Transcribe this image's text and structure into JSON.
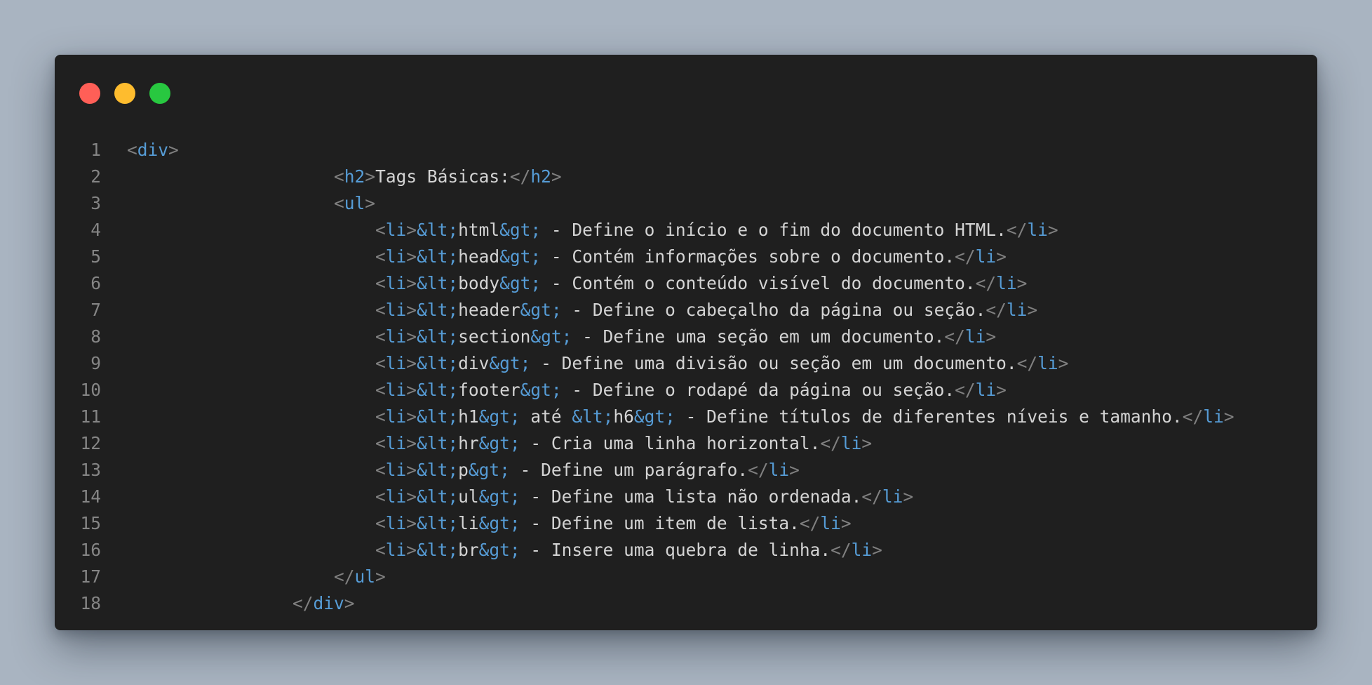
{
  "colors": {
    "background": "#a9b4c1",
    "window": "#1f1f1f",
    "dot_close": "#ff5f57",
    "dot_minimize": "#febc2e",
    "dot_maximize": "#28c840",
    "line_number": "#858585",
    "bracket": "#808080",
    "tag": "#569cd6",
    "entity": "#569cd6",
    "text": "#d4d4d4"
  },
  "window_controls": {
    "close_icon": "close-dot-icon",
    "minimize_icon": "minimize-dot-icon",
    "maximize_icon": "maximize-dot-icon"
  },
  "code": {
    "lines": [
      {
        "number": "1",
        "indent": "",
        "tokens": [
          {
            "t": "brk",
            "v": "<"
          },
          {
            "t": "tag",
            "v": "div"
          },
          {
            "t": "brk",
            "v": ">"
          }
        ]
      },
      {
        "number": "2",
        "indent": "                    ",
        "tokens": [
          {
            "t": "brk",
            "v": "<"
          },
          {
            "t": "tag",
            "v": "h2"
          },
          {
            "t": "brk",
            "v": ">"
          },
          {
            "t": "txt",
            "v": "Tags Básicas:"
          },
          {
            "t": "brk",
            "v": "</"
          },
          {
            "t": "tag",
            "v": "h2"
          },
          {
            "t": "brk",
            "v": ">"
          }
        ]
      },
      {
        "number": "3",
        "indent": "                    ",
        "tokens": [
          {
            "t": "brk",
            "v": "<"
          },
          {
            "t": "tag",
            "v": "ul"
          },
          {
            "t": "brk",
            "v": ">"
          }
        ]
      },
      {
        "number": "4",
        "indent": "                        ",
        "tokens": [
          {
            "t": "brk",
            "v": "<"
          },
          {
            "t": "tag",
            "v": "li"
          },
          {
            "t": "brk",
            "v": ">"
          },
          {
            "t": "ent",
            "v": "&lt;"
          },
          {
            "t": "txt",
            "v": "html"
          },
          {
            "t": "ent",
            "v": "&gt;"
          },
          {
            "t": "txt",
            "v": " - Define o início e o fim do documento HTML."
          },
          {
            "t": "brk",
            "v": "</"
          },
          {
            "t": "tag",
            "v": "li"
          },
          {
            "t": "brk",
            "v": ">"
          }
        ]
      },
      {
        "number": "5",
        "indent": "                        ",
        "tokens": [
          {
            "t": "brk",
            "v": "<"
          },
          {
            "t": "tag",
            "v": "li"
          },
          {
            "t": "brk",
            "v": ">"
          },
          {
            "t": "ent",
            "v": "&lt;"
          },
          {
            "t": "txt",
            "v": "head"
          },
          {
            "t": "ent",
            "v": "&gt;"
          },
          {
            "t": "txt",
            "v": " - Contém informações sobre o documento."
          },
          {
            "t": "brk",
            "v": "</"
          },
          {
            "t": "tag",
            "v": "li"
          },
          {
            "t": "brk",
            "v": ">"
          }
        ]
      },
      {
        "number": "6",
        "indent": "                        ",
        "tokens": [
          {
            "t": "brk",
            "v": "<"
          },
          {
            "t": "tag",
            "v": "li"
          },
          {
            "t": "brk",
            "v": ">"
          },
          {
            "t": "ent",
            "v": "&lt;"
          },
          {
            "t": "txt",
            "v": "body"
          },
          {
            "t": "ent",
            "v": "&gt;"
          },
          {
            "t": "txt",
            "v": " - Contém o conteúdo visível do documento."
          },
          {
            "t": "brk",
            "v": "</"
          },
          {
            "t": "tag",
            "v": "li"
          },
          {
            "t": "brk",
            "v": ">"
          }
        ]
      },
      {
        "number": "7",
        "indent": "                        ",
        "tokens": [
          {
            "t": "brk",
            "v": "<"
          },
          {
            "t": "tag",
            "v": "li"
          },
          {
            "t": "brk",
            "v": ">"
          },
          {
            "t": "ent",
            "v": "&lt;"
          },
          {
            "t": "txt",
            "v": "header"
          },
          {
            "t": "ent",
            "v": "&gt;"
          },
          {
            "t": "txt",
            "v": " - Define o cabeçalho da página ou seção."
          },
          {
            "t": "brk",
            "v": "</"
          },
          {
            "t": "tag",
            "v": "li"
          },
          {
            "t": "brk",
            "v": ">"
          }
        ]
      },
      {
        "number": "8",
        "indent": "                        ",
        "tokens": [
          {
            "t": "brk",
            "v": "<"
          },
          {
            "t": "tag",
            "v": "li"
          },
          {
            "t": "brk",
            "v": ">"
          },
          {
            "t": "ent",
            "v": "&lt;"
          },
          {
            "t": "txt",
            "v": "section"
          },
          {
            "t": "ent",
            "v": "&gt;"
          },
          {
            "t": "txt",
            "v": " - Define uma seção em um documento."
          },
          {
            "t": "brk",
            "v": "</"
          },
          {
            "t": "tag",
            "v": "li"
          },
          {
            "t": "brk",
            "v": ">"
          }
        ]
      },
      {
        "number": "9",
        "indent": "                        ",
        "tokens": [
          {
            "t": "brk",
            "v": "<"
          },
          {
            "t": "tag",
            "v": "li"
          },
          {
            "t": "brk",
            "v": ">"
          },
          {
            "t": "ent",
            "v": "&lt;"
          },
          {
            "t": "txt",
            "v": "div"
          },
          {
            "t": "ent",
            "v": "&gt;"
          },
          {
            "t": "txt",
            "v": " - Define uma divisão ou seção em um documento."
          },
          {
            "t": "brk",
            "v": "</"
          },
          {
            "t": "tag",
            "v": "li"
          },
          {
            "t": "brk",
            "v": ">"
          }
        ]
      },
      {
        "number": "10",
        "indent": "                        ",
        "tokens": [
          {
            "t": "brk",
            "v": "<"
          },
          {
            "t": "tag",
            "v": "li"
          },
          {
            "t": "brk",
            "v": ">"
          },
          {
            "t": "ent",
            "v": "&lt;"
          },
          {
            "t": "txt",
            "v": "footer"
          },
          {
            "t": "ent",
            "v": "&gt;"
          },
          {
            "t": "txt",
            "v": " - Define o rodapé da página ou seção."
          },
          {
            "t": "brk",
            "v": "</"
          },
          {
            "t": "tag",
            "v": "li"
          },
          {
            "t": "brk",
            "v": ">"
          }
        ]
      },
      {
        "number": "11",
        "indent": "                        ",
        "tokens": [
          {
            "t": "brk",
            "v": "<"
          },
          {
            "t": "tag",
            "v": "li"
          },
          {
            "t": "brk",
            "v": ">"
          },
          {
            "t": "ent",
            "v": "&lt;"
          },
          {
            "t": "txt",
            "v": "h1"
          },
          {
            "t": "ent",
            "v": "&gt;"
          },
          {
            "t": "txt",
            "v": " até "
          },
          {
            "t": "ent",
            "v": "&lt;"
          },
          {
            "t": "txt",
            "v": "h6"
          },
          {
            "t": "ent",
            "v": "&gt;"
          },
          {
            "t": "txt",
            "v": " - Define títulos de diferentes níveis e tamanho."
          },
          {
            "t": "brk",
            "v": "</"
          },
          {
            "t": "tag",
            "v": "li"
          },
          {
            "t": "brk",
            "v": ">"
          }
        ]
      },
      {
        "number": "12",
        "indent": "                        ",
        "tokens": [
          {
            "t": "brk",
            "v": "<"
          },
          {
            "t": "tag",
            "v": "li"
          },
          {
            "t": "brk",
            "v": ">"
          },
          {
            "t": "ent",
            "v": "&lt;"
          },
          {
            "t": "txt",
            "v": "hr"
          },
          {
            "t": "ent",
            "v": "&gt;"
          },
          {
            "t": "txt",
            "v": " - Cria uma linha horizontal."
          },
          {
            "t": "brk",
            "v": "</"
          },
          {
            "t": "tag",
            "v": "li"
          },
          {
            "t": "brk",
            "v": ">"
          }
        ]
      },
      {
        "number": "13",
        "indent": "                        ",
        "tokens": [
          {
            "t": "brk",
            "v": "<"
          },
          {
            "t": "tag",
            "v": "li"
          },
          {
            "t": "brk",
            "v": ">"
          },
          {
            "t": "ent",
            "v": "&lt;"
          },
          {
            "t": "txt",
            "v": "p"
          },
          {
            "t": "ent",
            "v": "&gt;"
          },
          {
            "t": "txt",
            "v": " - Define um parágrafo."
          },
          {
            "t": "brk",
            "v": "</"
          },
          {
            "t": "tag",
            "v": "li"
          },
          {
            "t": "brk",
            "v": ">"
          }
        ]
      },
      {
        "number": "14",
        "indent": "                        ",
        "tokens": [
          {
            "t": "brk",
            "v": "<"
          },
          {
            "t": "tag",
            "v": "li"
          },
          {
            "t": "brk",
            "v": ">"
          },
          {
            "t": "ent",
            "v": "&lt;"
          },
          {
            "t": "txt",
            "v": "ul"
          },
          {
            "t": "ent",
            "v": "&gt;"
          },
          {
            "t": "txt",
            "v": " - Define uma lista não ordenada."
          },
          {
            "t": "brk",
            "v": "</"
          },
          {
            "t": "tag",
            "v": "li"
          },
          {
            "t": "brk",
            "v": ">"
          }
        ]
      },
      {
        "number": "15",
        "indent": "                        ",
        "tokens": [
          {
            "t": "brk",
            "v": "<"
          },
          {
            "t": "tag",
            "v": "li"
          },
          {
            "t": "brk",
            "v": ">"
          },
          {
            "t": "ent",
            "v": "&lt;"
          },
          {
            "t": "txt",
            "v": "li"
          },
          {
            "t": "ent",
            "v": "&gt;"
          },
          {
            "t": "txt",
            "v": " - Define um item de lista."
          },
          {
            "t": "brk",
            "v": "</"
          },
          {
            "t": "tag",
            "v": "li"
          },
          {
            "t": "brk",
            "v": ">"
          }
        ]
      },
      {
        "number": "16",
        "indent": "                        ",
        "tokens": [
          {
            "t": "brk",
            "v": "<"
          },
          {
            "t": "tag",
            "v": "li"
          },
          {
            "t": "brk",
            "v": ">"
          },
          {
            "t": "ent",
            "v": "&lt;"
          },
          {
            "t": "txt",
            "v": "br"
          },
          {
            "t": "ent",
            "v": "&gt;"
          },
          {
            "t": "txt",
            "v": " - Insere uma quebra de linha."
          },
          {
            "t": "brk",
            "v": "</"
          },
          {
            "t": "tag",
            "v": "li"
          },
          {
            "t": "brk",
            "v": ">"
          }
        ]
      },
      {
        "number": "17",
        "indent": "                    ",
        "tokens": [
          {
            "t": "brk",
            "v": "</"
          },
          {
            "t": "tag",
            "v": "ul"
          },
          {
            "t": "brk",
            "v": ">"
          }
        ]
      },
      {
        "number": "18",
        "indent": "                ",
        "tokens": [
          {
            "t": "brk",
            "v": "</"
          },
          {
            "t": "tag",
            "v": "div"
          },
          {
            "t": "brk",
            "v": ">"
          }
        ]
      }
    ]
  }
}
